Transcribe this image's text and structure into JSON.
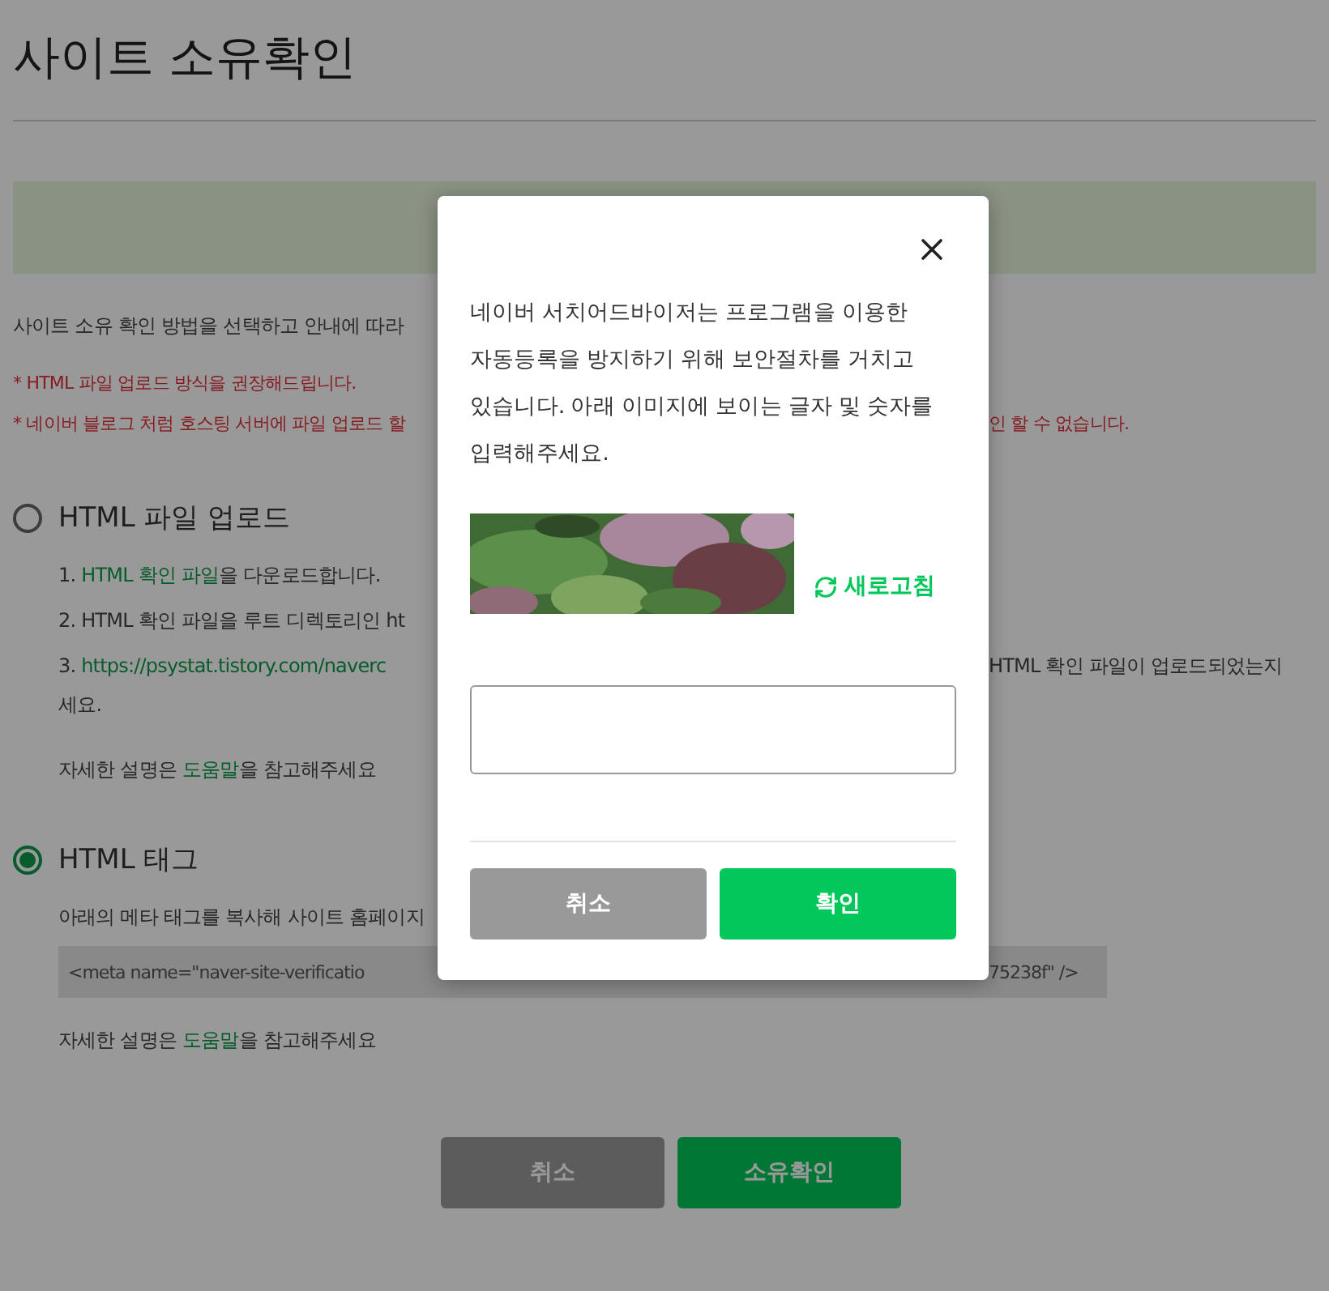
{
  "page": {
    "title": "사이트 소유확인",
    "intro": "사이트 소유 확인 방법을 선택하고 안내에 따라",
    "notes": [
      {
        "left": "* HTML 파일 업로드 방식을 권장해드립니다."
      },
      {
        "left": "* 네이버 블로그 처럼 호스팅 서버에 파일 업로드 할",
        "right": "인 할 수 없습니다."
      }
    ]
  },
  "methods": [
    {
      "label": "HTML 파일 업로드",
      "selected": false,
      "steps": [
        {
          "parts": [
            {
              "text": "1. "
            },
            {
              "text": "HTML 확인 파일",
              "link": true
            },
            {
              "text": "을 다운로드합니다."
            }
          ]
        },
        {
          "parts": [
            {
              "text": "2. HTML 확인 파일을 루트 디렉토리인 ht"
            }
          ]
        },
        {
          "parts": [
            {
              "text": "3. "
            },
            {
              "text": "https://psystat.tistory.com/naverc",
              "link": true
            }
          ],
          "right": "HTML 확인 파일이 업로드되었는지",
          "continuation": "세요."
        }
      ],
      "help": [
        {
          "text": "자세한 설명은 "
        },
        {
          "text": "도움말",
          "link": true
        },
        {
          "text": "을 참고해주세요"
        }
      ]
    },
    {
      "label": "HTML 태그",
      "selected": true,
      "description": "아래의 메타 태그를 복사해 사이트 홈페이지",
      "meta": {
        "left": "<meta name=\"naver-site-verificatio",
        "right": "75238f\" />"
      },
      "help": [
        {
          "text": "자세한 설명은 "
        },
        {
          "text": "도움말",
          "link": true
        },
        {
          "text": "을 참고해주세요"
        }
      ]
    }
  ],
  "footer_buttons": [
    {
      "label": "취소",
      "kind": "secondary"
    },
    {
      "label": "소유확인",
      "kind": "primary"
    }
  ],
  "modal": {
    "message": "네이버 서치어드바이저는 프로그램을 이용한 자동등록을 방지하기 위해 보안절차를 거치고 있습니다. 아래 이미지에 보이는 글자 및 숫자를 입력해주세요.",
    "refresh": "새로고침",
    "buttons": [
      {
        "label": "취소",
        "kind": "secondary"
      },
      {
        "label": "확인",
        "kind": "primary"
      }
    ]
  }
}
